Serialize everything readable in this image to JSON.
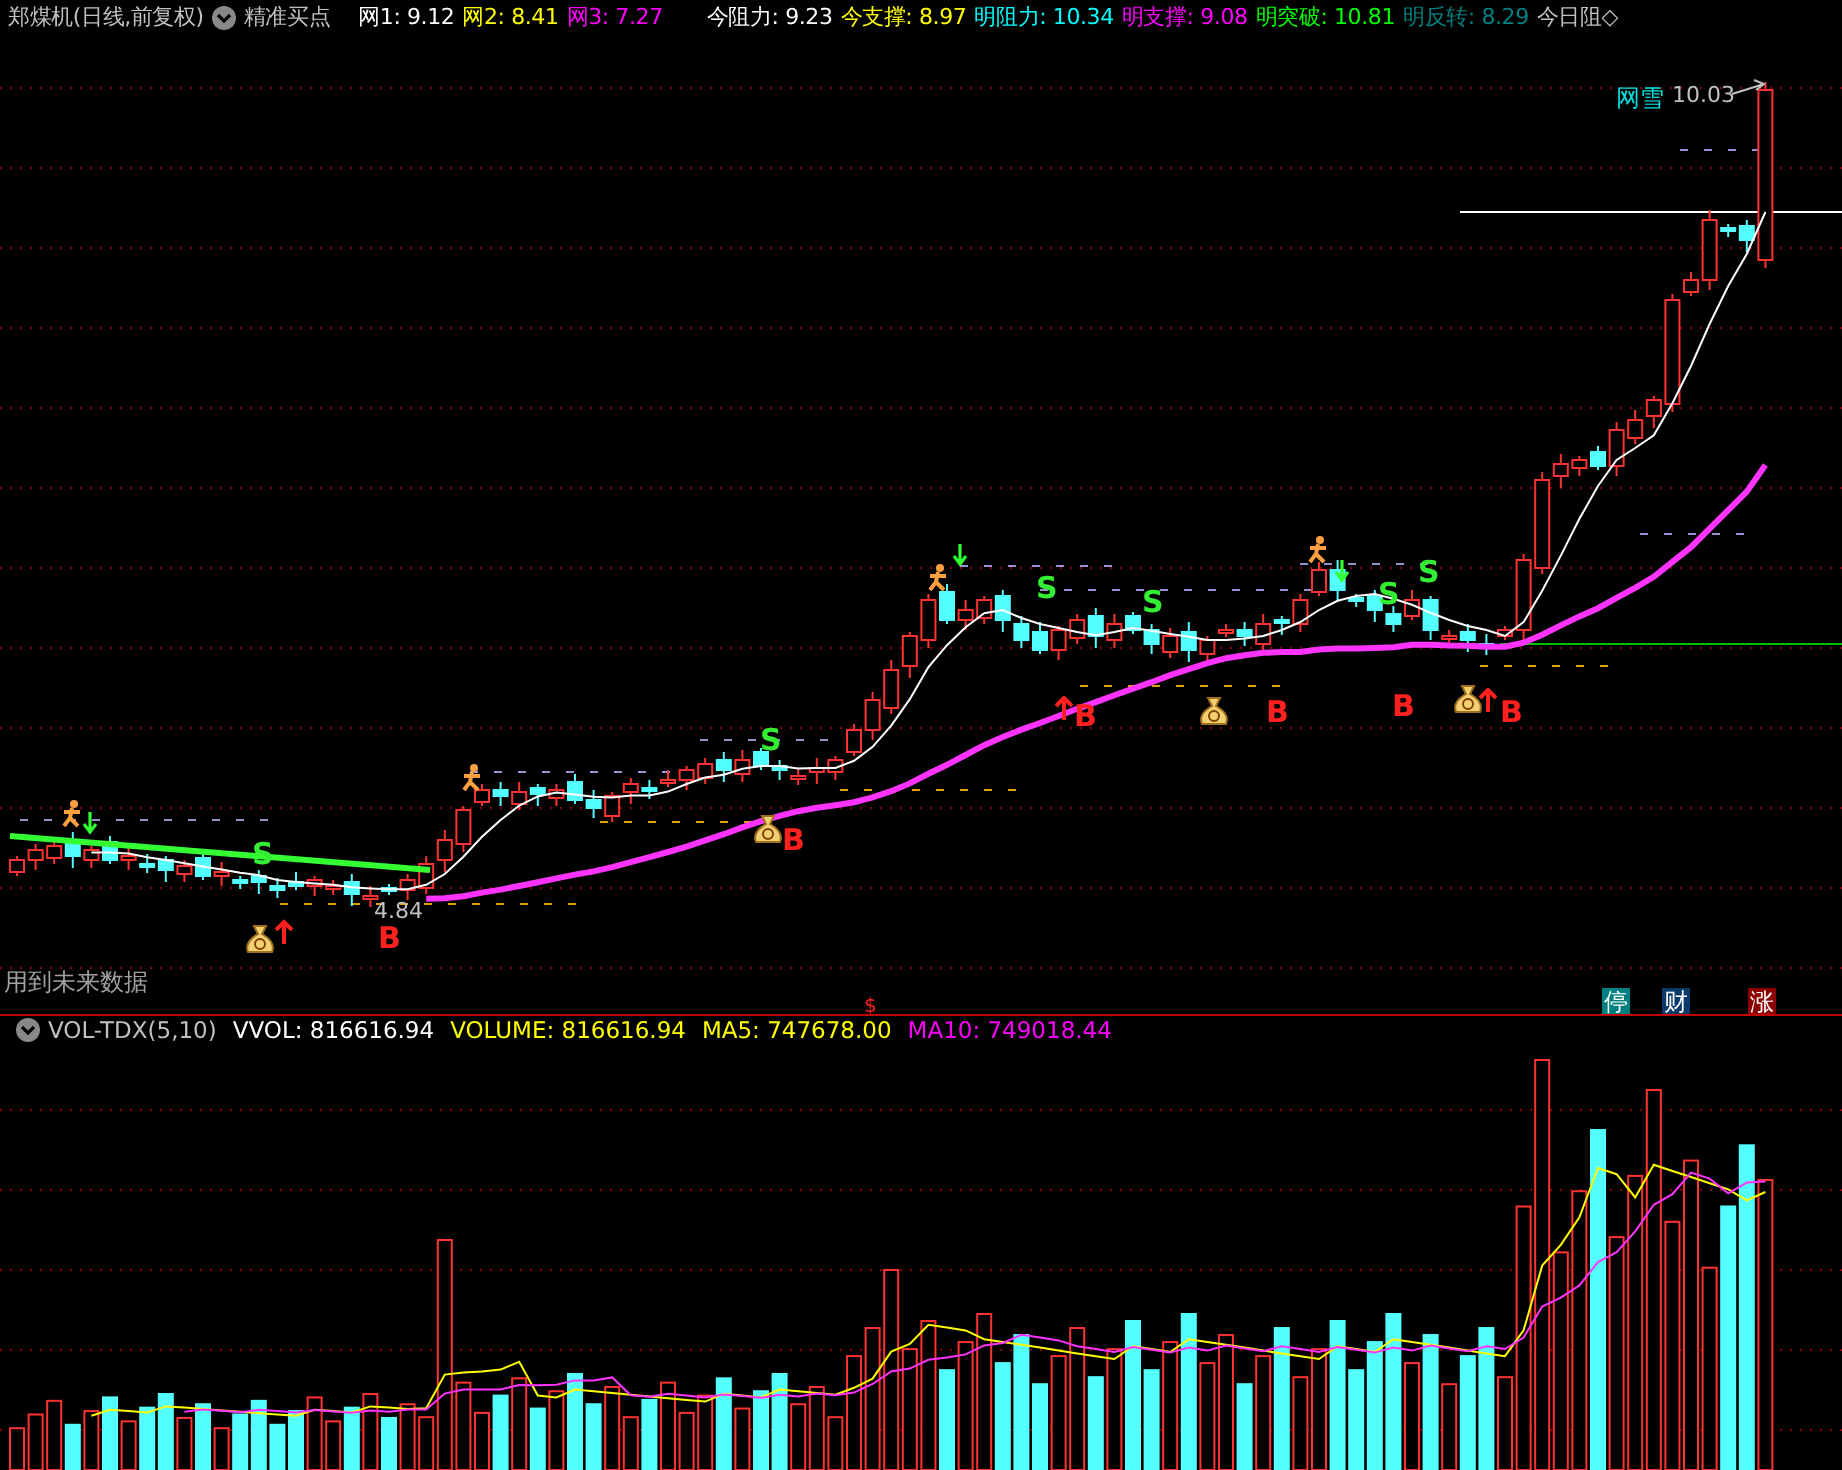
{
  "header": {
    "title": "郑煤机(日线,前复权)",
    "indicator": "精准买点",
    "values": [
      {
        "text": "网1: 9.12",
        "color": "#ffffff"
      },
      {
        "text": "网2: 8.41",
        "color": "#ffff00"
      },
      {
        "text": "网3: 7.27",
        "color": "#ff00ff"
      },
      {
        "text": "今阻力: 9.23",
        "color": "#ffffff"
      },
      {
        "text": "今支撑: 8.97",
        "color": "#ffff00"
      },
      {
        "text": "明阻力: 10.34",
        "color": "#00ffff"
      },
      {
        "text": "明支撑: 9.08",
        "color": "#ff00ff"
      },
      {
        "text": "明突破: 10.81",
        "color": "#00ff00"
      },
      {
        "text": "明反转: 8.29",
        "color": "#008080"
      },
      {
        "text": "今日阻◇",
        "color": "#c0c0c0"
      }
    ]
  },
  "price_chart": {
    "signals": [
      {
        "kind": "sell",
        "text": "S"
      },
      {
        "kind": "buy",
        "text": "B"
      },
      {
        "kind": "sell",
        "text": "S"
      },
      {
        "kind": "buy",
        "text": "B"
      },
      {
        "kind": "sell",
        "text": "S"
      },
      {
        "kind": "buy",
        "text": "B"
      },
      {
        "kind": "sell",
        "text": "S"
      },
      {
        "kind": "buy",
        "text": "B"
      },
      {
        "kind": "sell",
        "text": "S"
      },
      {
        "kind": "sell",
        "text": "S"
      },
      {
        "kind": "buy",
        "text": "B"
      },
      {
        "kind": "buy",
        "text": "B"
      }
    ],
    "low_label": "4.84",
    "peak_label": {
      "name": "网雪",
      "value": "10.03"
    },
    "warning": "用到未来数据",
    "marker": "$",
    "tags": [
      {
        "text": "停",
        "color": "#008080"
      },
      {
        "text": "财",
        "color": "#0a3a6a"
      },
      {
        "text": "涨",
        "color": "#8b0000"
      }
    ]
  },
  "volume_panel": {
    "indicator": "VOL-TDX(5,10)",
    "values": [
      {
        "text": "VVOL: 816616.94",
        "color": "#ffffff"
      },
      {
        "text": "VOLUME: 816616.94",
        "color": "#ffff00"
      },
      {
        "text": "MA5: 747678.00",
        "color": "#ffff00"
      },
      {
        "text": "MA10: 749018.44",
        "color": "#ff00ff"
      }
    ]
  }
}
